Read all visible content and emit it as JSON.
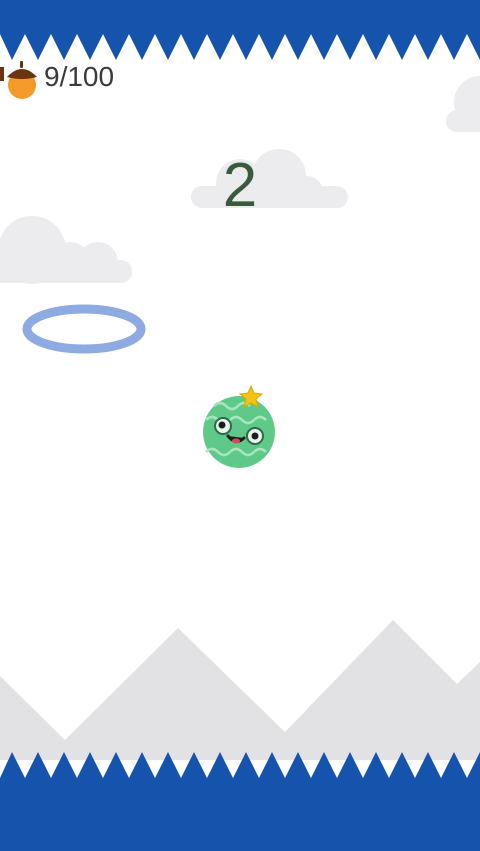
{
  "game": {
    "score": "2",
    "acorns": "9/100"
  },
  "colors": {
    "background": "#ffffff",
    "border": "#1553ad",
    "mountains": "#e2e2e4",
    "clouds": "#ececee",
    "ring": "#8dabe0",
    "ball": "#5fc98a",
    "star": "#f1c40f",
    "acorn_cap": "#6b3410",
    "acorn_body": "#f39a2b"
  },
  "icons": {
    "currency": "acorn-icon",
    "player": "melon-ball-character",
    "goal": "hoop-ring"
  }
}
